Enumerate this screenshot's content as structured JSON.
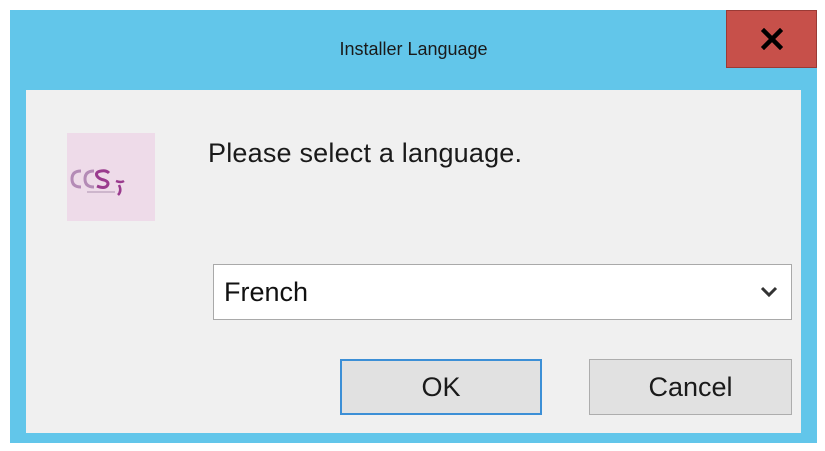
{
  "window": {
    "title": "Installer Language",
    "close_icon": "close-icon"
  },
  "dialog": {
    "prompt": "Please select a language.",
    "logo_icon": "ocs-logo-icon",
    "language_select": {
      "value": "French",
      "arrow_icon": "chevron-down-icon"
    },
    "ok_label": "OK",
    "cancel_label": "Cancel"
  },
  "colors": {
    "titlebar": "#62c6ea",
    "close_button": "#c7504a",
    "client_background": "#f0f0f0",
    "focus_border": "#3c8fd6"
  }
}
